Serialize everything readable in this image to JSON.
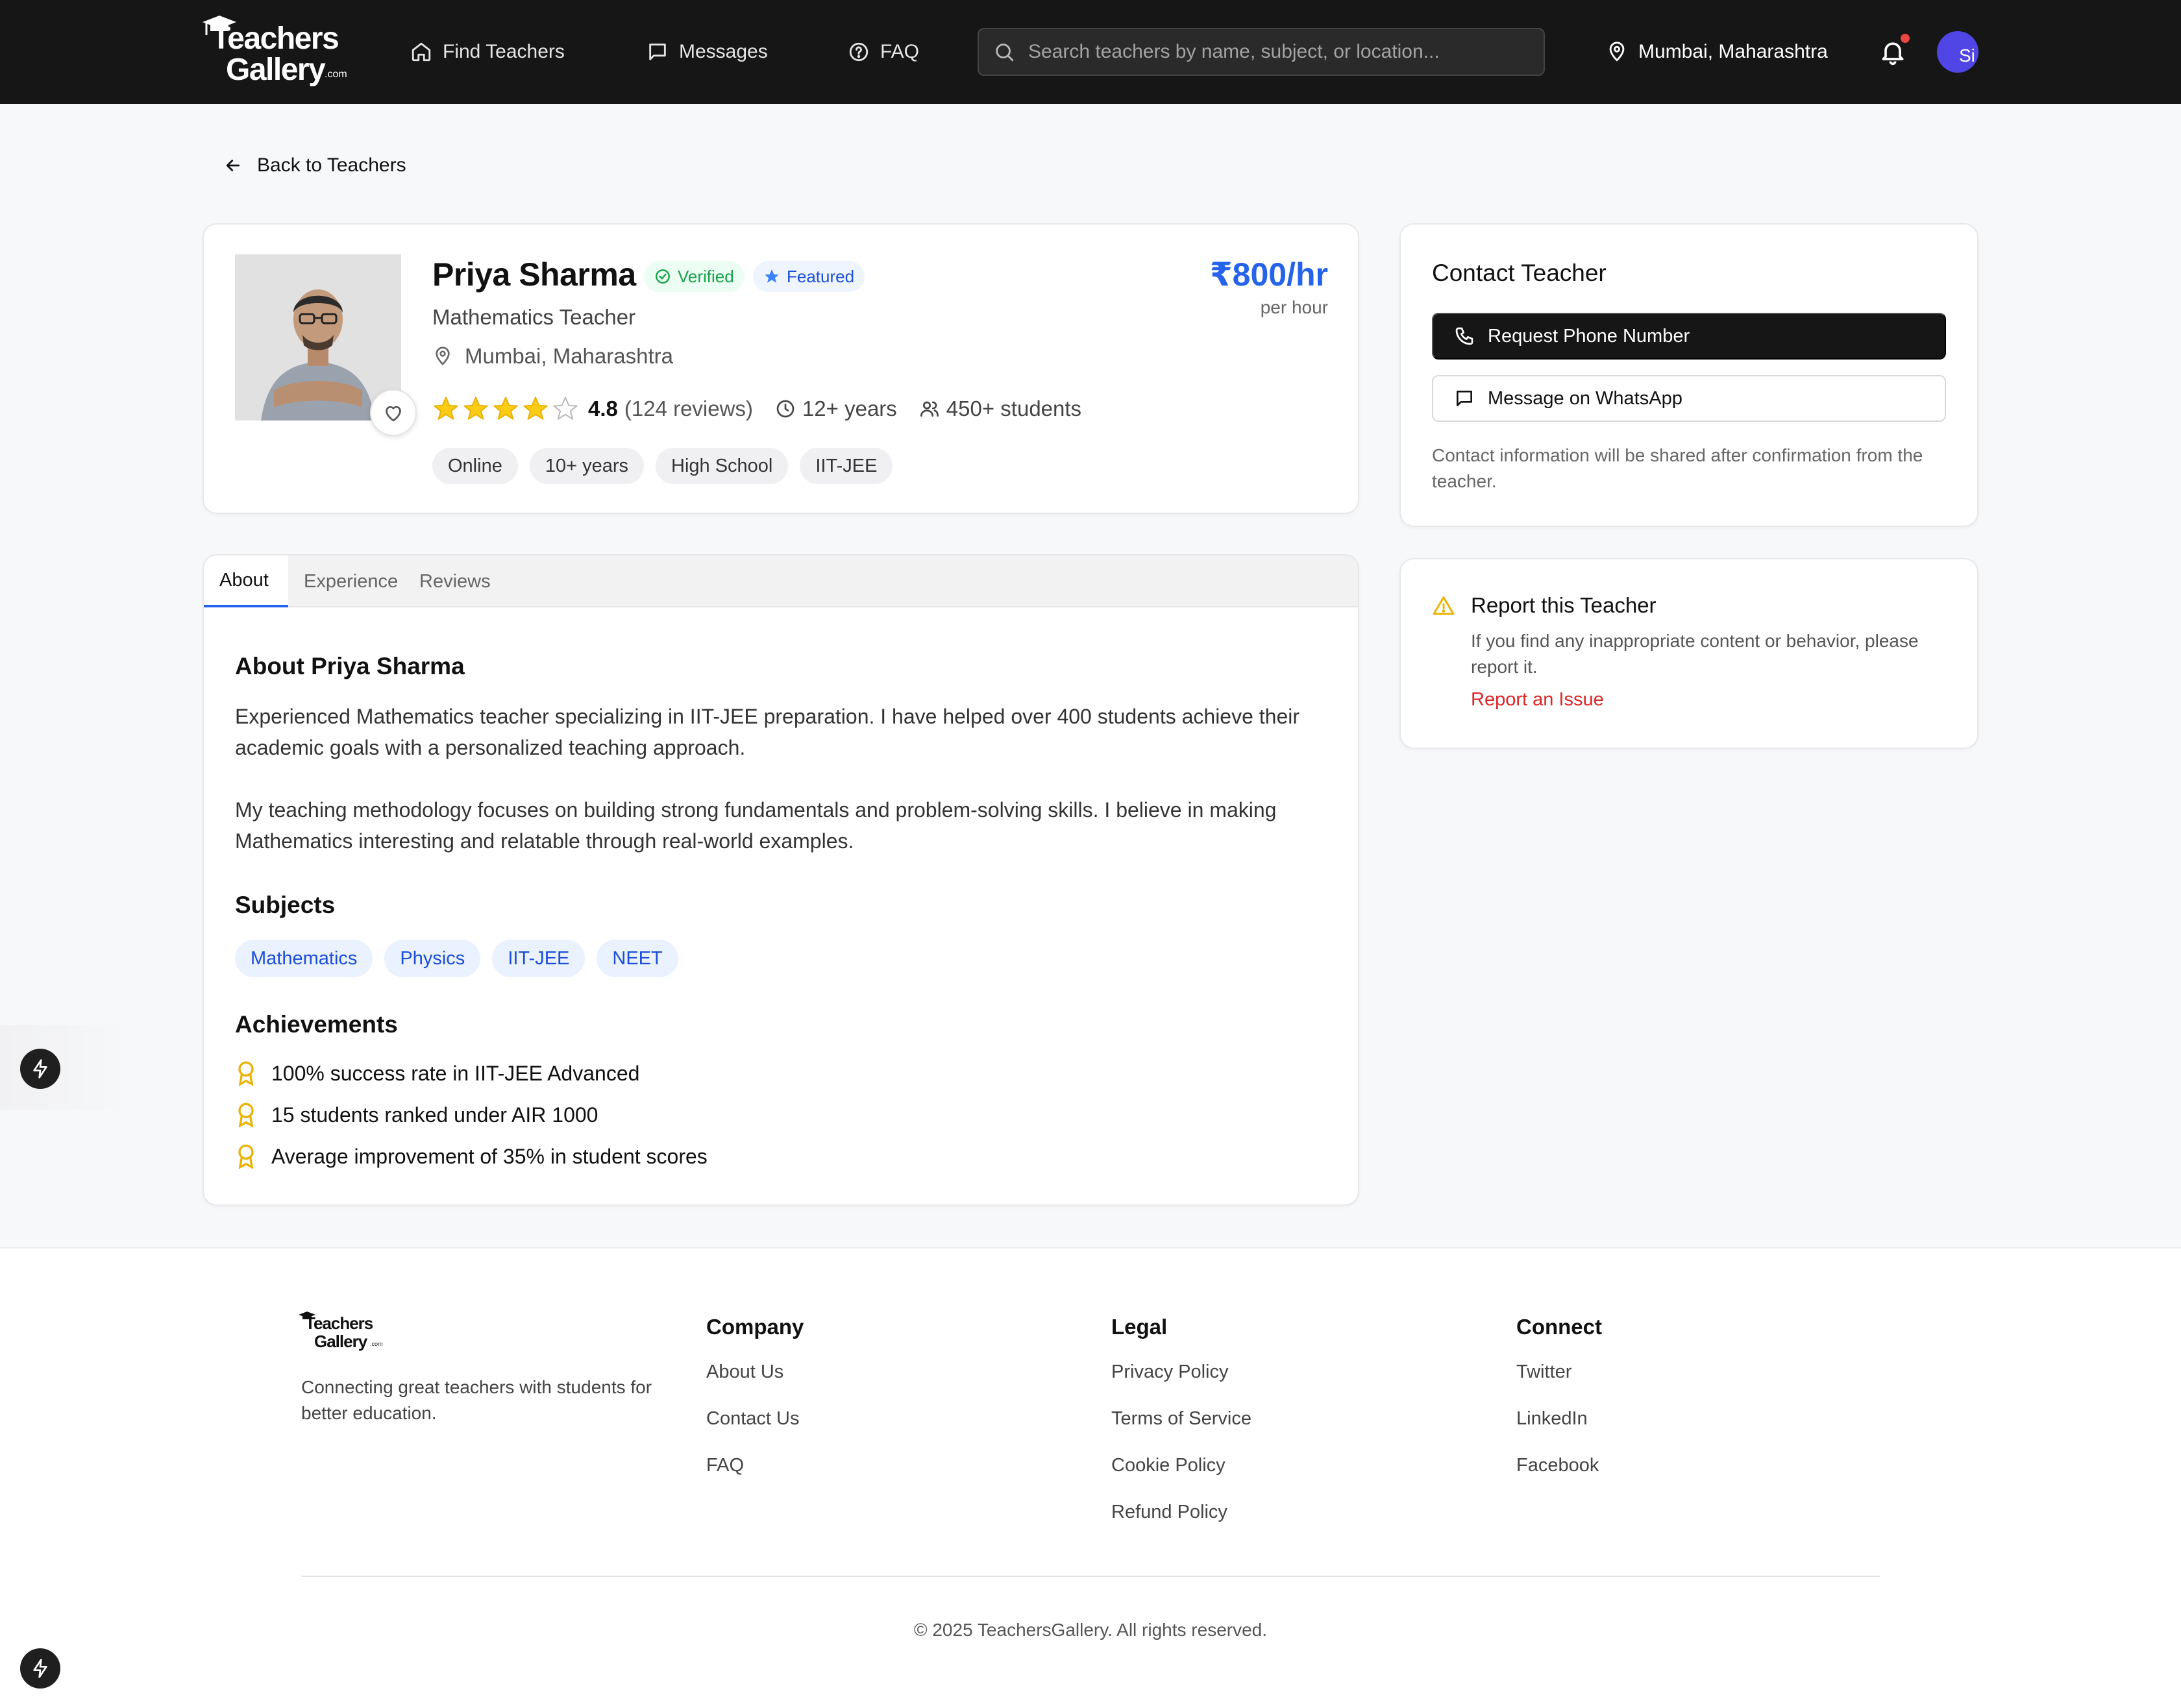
{
  "nav": {
    "logo": {
      "line1": "Teachers",
      "line2": "Gallery",
      "suffix": ".com"
    },
    "links": [
      {
        "label": "Find Teachers",
        "icon": "home-icon"
      },
      {
        "label": "Messages",
        "icon": "message-icon"
      },
      {
        "label": "FAQ",
        "icon": "help-circle-icon"
      }
    ],
    "search_placeholder": "Search teachers by name, subject, or location...",
    "location": "Mumbai, Maharashtra",
    "avatar_text": "Si",
    "notification_dot_color": "#ef4444"
  },
  "back_label": "Back to Teachers",
  "profile": {
    "name": "Priya Sharma",
    "verified_label": "Verified",
    "featured_label": "Featured",
    "subtitle": "Mathematics Teacher",
    "location": "Mumbai, Maharashtra",
    "rating": "4.8",
    "rating_stars_filled": 4,
    "rating_stars_total": 5,
    "reviews": "(124 reviews)",
    "experience": "12+ years",
    "students": "450+ students",
    "tags": [
      "Online",
      "10+ years",
      "High School",
      "IIT-JEE"
    ],
    "price": "₹800/hr",
    "price_unit": "per hour",
    "accent_color": "#2563eb"
  },
  "tabs": [
    {
      "label": "About",
      "active": true
    },
    {
      "label": "Experience",
      "active": false
    },
    {
      "label": "Reviews",
      "active": false
    }
  ],
  "about": {
    "heading": "About Priya Sharma",
    "paragraph1": "Experienced Mathematics teacher specializing in IIT-JEE preparation. I have helped over 400 students achieve their academic goals with a personalized teaching approach.",
    "paragraph2": "My teaching methodology focuses on building strong fundamentals and problem-solving skills. I believe in making Mathematics interesting and relatable through real-world examples.",
    "subjects_heading": "Subjects",
    "subjects": [
      "Mathematics",
      "Physics",
      "IIT-JEE",
      "NEET"
    ],
    "achievements_heading": "Achievements",
    "achievements": [
      "100% success rate in IIT-JEE Advanced",
      "15 students ranked under AIR 1000",
      "Average improvement of 35% in student scores"
    ]
  },
  "contact": {
    "title": "Contact Teacher",
    "phone_button": "Request Phone Number",
    "whatsapp_button": "Message on WhatsApp",
    "note": "Contact information will be shared after confirmation from the teacher."
  },
  "report": {
    "title": "Report this Teacher",
    "text": "If you find any inappropriate content or behavior, please report it.",
    "link": "Report an Issue",
    "link_color": "#dc2626",
    "icon_color": "#eab308"
  },
  "footer": {
    "logo": {
      "line1": "Teachers",
      "line2": "Gallery",
      "suffix": ".com"
    },
    "description": "Connecting great teachers with students for better education.",
    "columns": [
      {
        "title": "Company",
        "links": [
          "About Us",
          "Contact Us",
          "FAQ"
        ]
      },
      {
        "title": "Legal",
        "links": [
          "Privacy Policy",
          "Terms of Service",
          "Cookie Policy",
          "Refund Policy"
        ]
      },
      {
        "title": "Connect",
        "links": [
          "Twitter",
          "LinkedIn",
          "Facebook"
        ]
      }
    ],
    "copyright": "© 2025 TeachersGallery. All rights reserved."
  }
}
